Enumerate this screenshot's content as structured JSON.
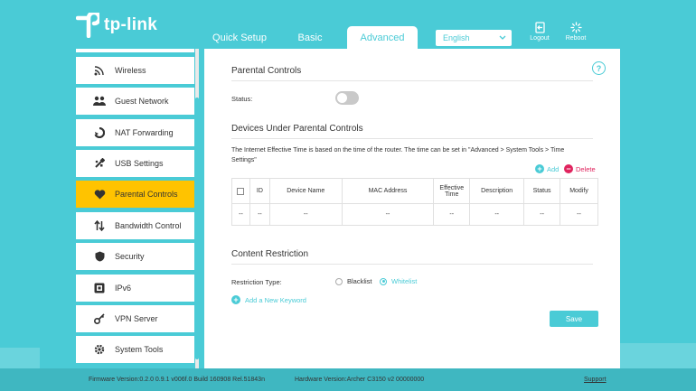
{
  "header": {
    "logo_text": "tp-link",
    "tabs": [
      {
        "label": "Quick Setup"
      },
      {
        "label": "Basic"
      },
      {
        "label": "Advanced",
        "active": true
      }
    ],
    "language": "English",
    "logout_label": "Logout",
    "reboot_label": "Reboot"
  },
  "sidebar": {
    "items": [
      {
        "label": "Wireless",
        "icon": "wifi-icon"
      },
      {
        "label": "Guest Network",
        "icon": "guest-users-icon"
      },
      {
        "label": "NAT Forwarding",
        "icon": "nat-forwarding-icon"
      },
      {
        "label": "USB Settings",
        "icon": "usb-icon"
      },
      {
        "label": "Parental Controls",
        "icon": "heart-icon",
        "active": true
      },
      {
        "label": "Bandwidth Control",
        "icon": "up-down-arrows-icon"
      },
      {
        "label": "Security",
        "icon": "shield-icon"
      },
      {
        "label": "IPv6",
        "icon": "ipv6-icon"
      },
      {
        "label": "VPN Server",
        "icon": "vpn-key-icon"
      },
      {
        "label": "System Tools",
        "icon": "gear-icon"
      }
    ]
  },
  "parental": {
    "title": "Parental Controls",
    "status_label": "Status:",
    "status_on": false
  },
  "devices": {
    "title": "Devices Under Parental Controls",
    "note": "The Internet Effective Time is based on the time of the router. The time can be set in \"Advanced > System Tools > Time Settings\"",
    "add_label": "Add",
    "delete_label": "Delete",
    "columns": [
      "ID",
      "Device Name",
      "MAC Address",
      "Effective Time",
      "Description",
      "Status",
      "Modify"
    ],
    "row": [
      "--",
      "--",
      "--",
      "--",
      "--",
      "--",
      "--",
      "--"
    ]
  },
  "content": {
    "title": "Content Restriction",
    "restriction_label": "Restriction Type:",
    "blacklist_label": "Blacklist",
    "whitelist_label": "Whitelist",
    "selected": "Whitelist",
    "add_keyword_label": "Add a New Keyword",
    "save_label": "Save"
  },
  "footer": {
    "firmware": "Firmware Version:0.2.0 0.9.1 v006f.0 Build 160908 Rel.51843n",
    "hardware": "Hardware Version:Archer C3150 v2 00000000",
    "support": "Support"
  },
  "colors": {
    "accent": "#4acbd6",
    "active_item": "#ffc300",
    "delete": "#e0245e"
  }
}
